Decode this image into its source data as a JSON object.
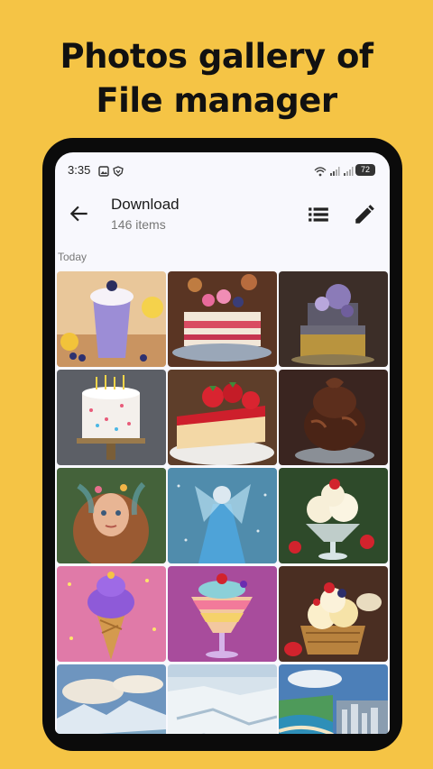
{
  "headline": {
    "line1": "Photos gallery of",
    "line2": "File manager"
  },
  "status_bar": {
    "time": "3:35",
    "battery": "72"
  },
  "app_bar": {
    "title": "Download",
    "item_count": "146 items"
  },
  "section": {
    "label": "Today"
  },
  "photos": [
    "blueberry-milkshake",
    "berry-layer-cake",
    "purple-floral-gold-cake",
    "birthday-candle-cake",
    "strawberry-cheesecake",
    "chocolate-ice-cream",
    "fairy-girl-portrait",
    "ice-fairy-woman",
    "vanilla-ice-cream-strawberries",
    "purple-ice-cream-cone",
    "layered-sundae-glass",
    "fruit-ice-cream-basket",
    "arctic-sky-mountains",
    "snowy-landscape-aerial",
    "coastal-city-aerial"
  ],
  "colors": {
    "background": "#F5C445",
    "phone_frame": "#0b0b0b",
    "screen": "#F8F8FD"
  }
}
